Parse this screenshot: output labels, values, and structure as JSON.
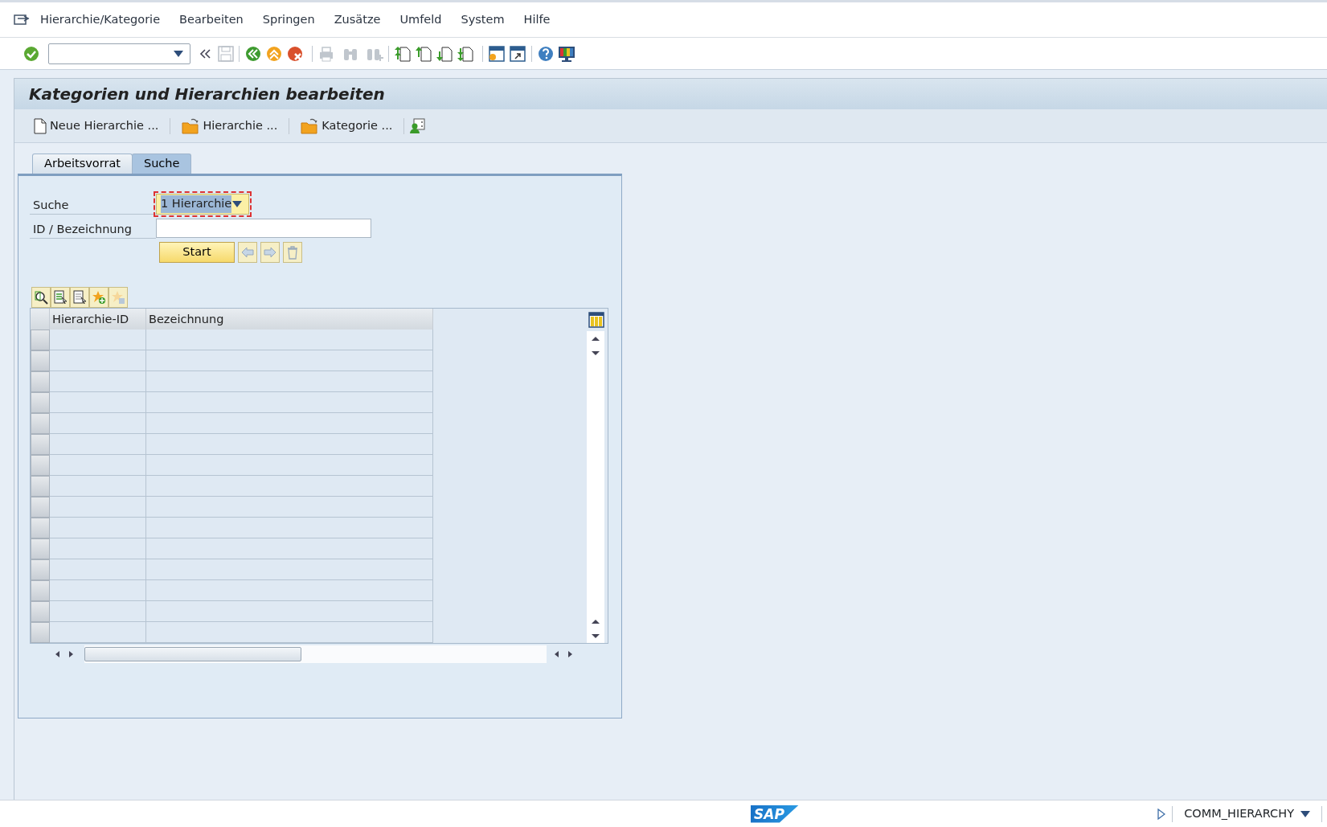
{
  "menu_bar": {
    "items": [
      "Hierarchie/Kategorie",
      "Bearbeiten",
      "Springen",
      "Zusätze",
      "Umfeld",
      "System",
      "Hilfe"
    ]
  },
  "title": "Kategorien und Hierarchien bearbeiten",
  "app_toolbar": {
    "buttons": [
      {
        "label": "Neue Hierarchie ...",
        "kind": "new"
      },
      {
        "label": "Hierarchie ...",
        "kind": "open"
      },
      {
        "label": "Kategorie ...",
        "kind": "open"
      }
    ]
  },
  "tabs": [
    {
      "label": "Arbeitsvorrat",
      "selected": false
    },
    {
      "label": "Suche",
      "selected": true
    }
  ],
  "search_form": {
    "search_label": "Suche",
    "search_value": "1 Hierarchie",
    "search_focused": true,
    "id_label": "ID / Bezeichnung",
    "start_button": "Start"
  },
  "table": {
    "columns": [
      "Hierarchie-ID",
      "Bezeichnung"
    ]
  },
  "status_bar": {
    "logo": "SAP",
    "transaction": "COMM_HIERARCHY"
  }
}
